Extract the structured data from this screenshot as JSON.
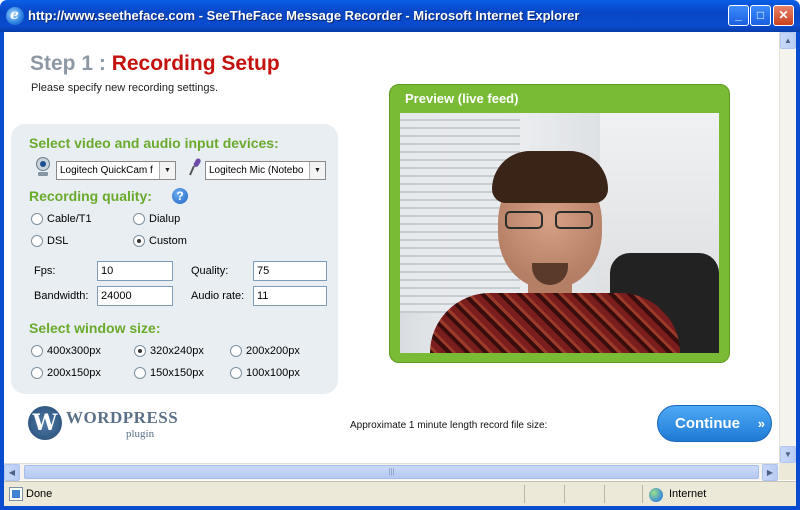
{
  "window": {
    "title": "http://www.seetheface.com - SeeTheFace Message Recorder - Microsoft Internet Explorer",
    "min_glyph": "_",
    "max_glyph": "□",
    "close_glyph": "✕"
  },
  "page": {
    "step": "Step 1 :",
    "title": "Recording Setup",
    "instructions": "Please specify new recording settings."
  },
  "devices": {
    "heading": "Select video and audio input devices:",
    "video_device": "Logitech QuickCam f",
    "audio_device": "Logitech Mic (Notebo"
  },
  "quality": {
    "heading": "Recording quality:",
    "options": [
      {
        "label": "Cable/T1",
        "selected": false
      },
      {
        "label": "Dialup",
        "selected": false
      },
      {
        "label": "DSL",
        "selected": false
      },
      {
        "label": "Custom",
        "selected": true
      }
    ],
    "fps_label": "Fps:",
    "fps_value": "10",
    "quality_label": "Quality:",
    "quality_value": "75",
    "bandwidth_label": "Bandwidth:",
    "bandwidth_value": "24000",
    "audio_rate_label": "Audio rate:",
    "audio_rate_value": "11"
  },
  "window_size": {
    "heading": "Select window size:",
    "options": [
      {
        "label": "400x300px",
        "selected": false
      },
      {
        "label": "320x240px",
        "selected": true
      },
      {
        "label": "200x200px",
        "selected": false
      },
      {
        "label": "200x150px",
        "selected": false
      },
      {
        "label": "150x150px",
        "selected": false
      },
      {
        "label": "100x100px",
        "selected": false
      }
    ]
  },
  "preview": {
    "heading": "Preview (live feed)"
  },
  "footer": {
    "wp_name": "WORDPRESS",
    "wp_plugin": "plugin",
    "filesize_label": "Approximate 1 minute length record file size:",
    "continue_label": "Continue",
    "continue_arrow": "»"
  },
  "statusbar": {
    "status": "Done",
    "zone": "Internet"
  },
  "colors": {
    "accent_green": "#79bb34",
    "title_red": "#c4120e",
    "button_blue": "#1f7ad6"
  }
}
